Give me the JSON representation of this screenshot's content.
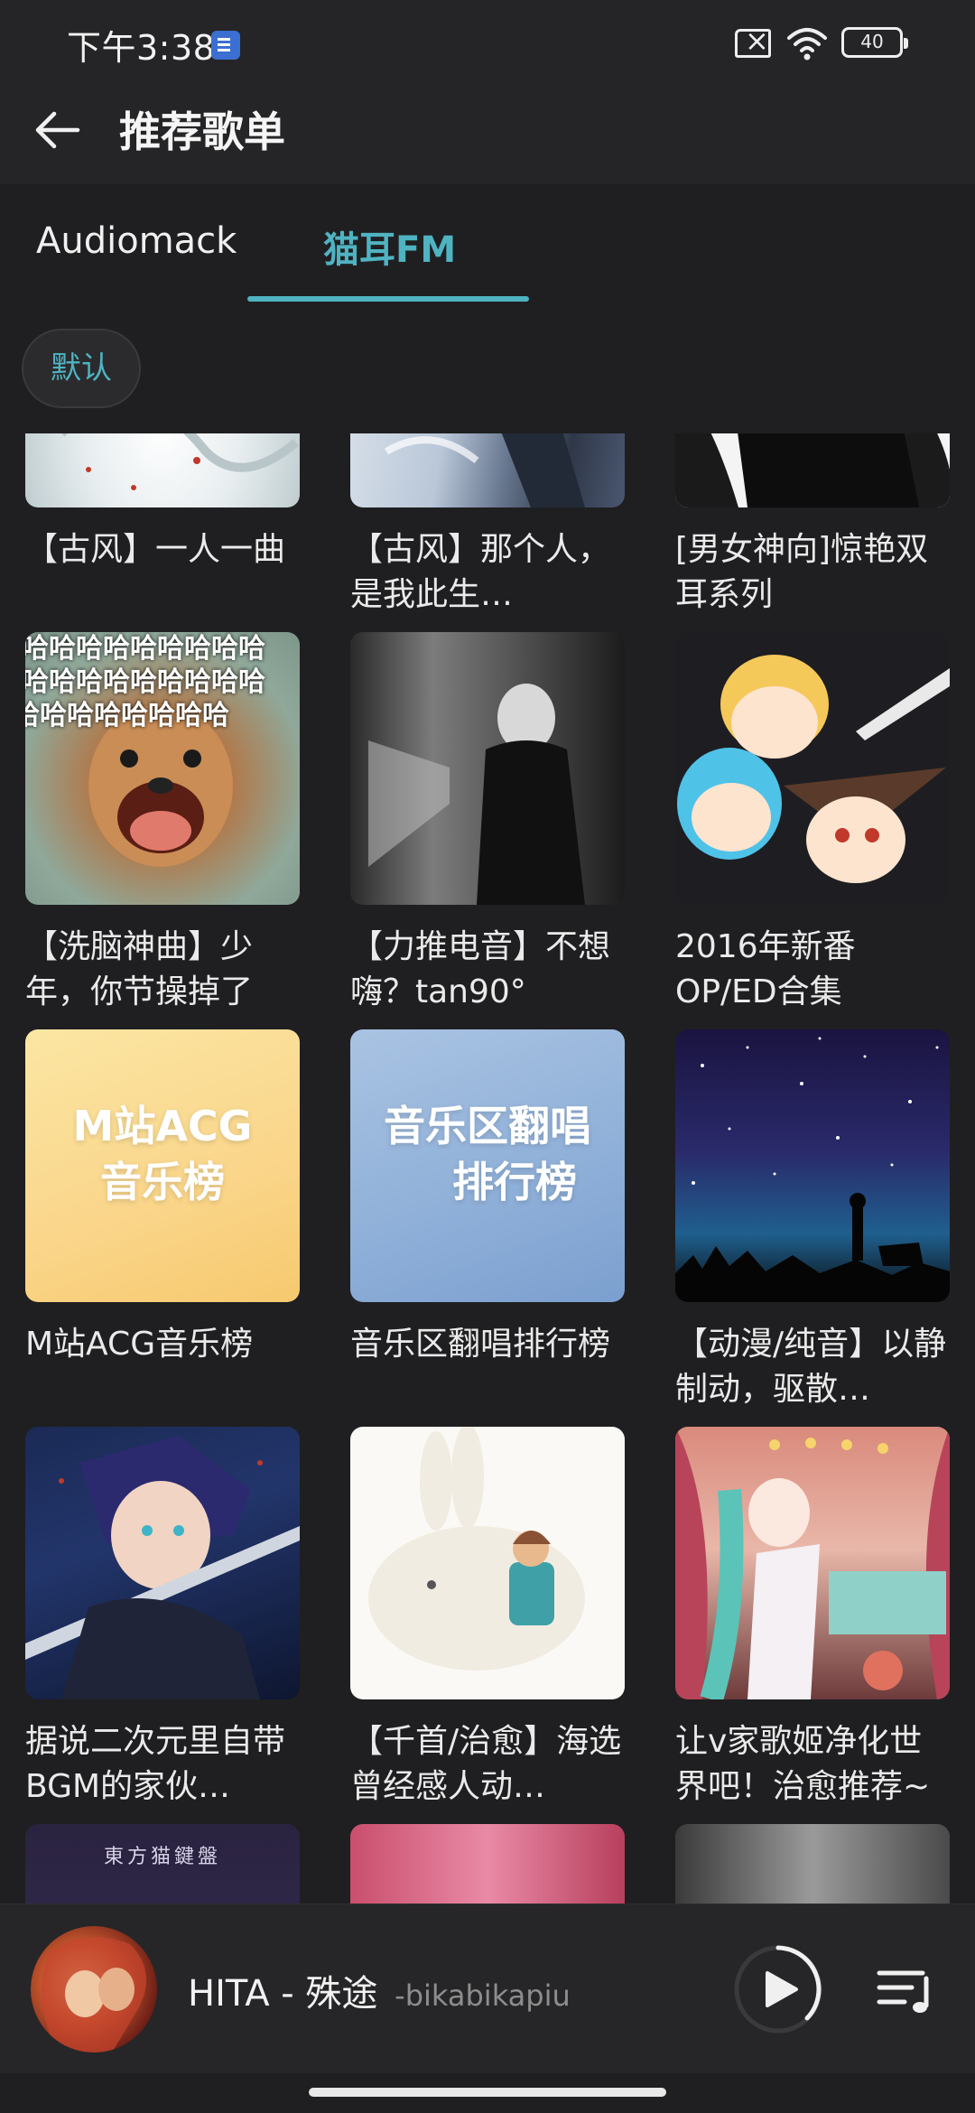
{
  "status_bar": {
    "time": "下午3:38",
    "battery": "40"
  },
  "app_bar": {
    "title": "推荐歌单"
  },
  "tabs": [
    {
      "label": "Audiomack",
      "selected": false
    },
    {
      "label": "猫耳FM",
      "selected": true
    }
  ],
  "filter_chip": {
    "label": "默认"
  },
  "playlists": [
    {
      "title": "【古风】一人一曲"
    },
    {
      "title": "【古风】那个人，是我此生…"
    },
    {
      "title": "[男女神向]惊艳双耳系列"
    },
    {
      "title": "【洗脑神曲】少年，你节操掉了"
    },
    {
      "title": "【力推电音】不想嗨？tan90°"
    },
    {
      "title": "2016年新番OP/ED合集"
    },
    {
      "title": "M站ACG音乐榜",
      "cover_text": [
        "M站ACG",
        "音乐榜"
      ]
    },
    {
      "title": "音乐区翻唱排行榜",
      "cover_text": [
        "音乐区翻唱",
        "排行榜"
      ]
    },
    {
      "title": "【动漫/纯音】以静制动，驱散…"
    },
    {
      "title": "据说二次元里自带BGM的家伙…"
    },
    {
      "title": "【千首/治愈】海选曾经感人动…"
    },
    {
      "title": "让v家歌姬净化世界吧！治愈推荐~"
    },
    {
      "title": "",
      "cover_text": [
        "東方猫鍵盤"
      ]
    },
    {
      "title": ""
    },
    {
      "title": ""
    }
  ],
  "cover_meme_text": "哈哈哈哈哈哈哈哈哈",
  "player": {
    "song": "HITA - 殊途",
    "artist": "-bikabikapiu"
  },
  "colors": {
    "accent": "#4fb3c2",
    "background": "#1f1f21",
    "surface": "#262628"
  }
}
